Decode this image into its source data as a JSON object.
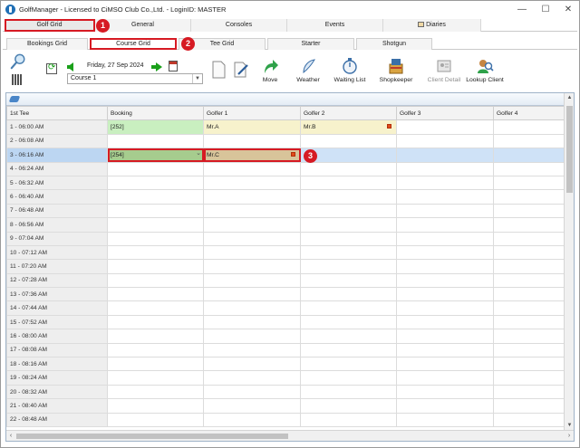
{
  "window": {
    "title": "GolfManager - Licensed to CiMSO Club Co.,Ltd. - LoginID: MASTER",
    "controls": [
      "—",
      "☐",
      "✕"
    ]
  },
  "main_tabs": [
    "Golf Grid",
    "General",
    "Consoles",
    "Events",
    "Diaries"
  ],
  "sub_tabs": [
    "Bookings Grid",
    "Course Grid",
    "Tee Grid",
    "Starter",
    "Shotgun"
  ],
  "badges": [
    "1",
    "2",
    "3"
  ],
  "date_nav": {
    "date": "Friday, 27 Sep 2024"
  },
  "course_select": {
    "value": "Course 1"
  },
  "toolbar": [
    {
      "label": "Move",
      "icon": "move-arrow-icon"
    },
    {
      "label": "Weather",
      "icon": "weather-icon"
    },
    {
      "label": "Waiting List",
      "icon": "stopwatch-icon"
    },
    {
      "label": "Shopkeeper",
      "icon": "shopkeeper-icon"
    },
    {
      "label": "Client Detail",
      "icon": "client-detail-icon"
    },
    {
      "label": "Lookup Client",
      "icon": "lookup-client-icon"
    }
  ],
  "grid": {
    "columns": [
      "1st Tee",
      "Booking",
      "Golfer 1",
      "Golfer 2",
      "Golfer 3",
      "Golfer 4"
    ],
    "rows": [
      {
        "tee": "1 - 06:00 AM",
        "booking": "[252]",
        "g1": "Mr.A",
        "g2": "Mr.B"
      },
      {
        "tee": "2 - 06:08 AM",
        "booking": "",
        "g1": "",
        "g2": ""
      },
      {
        "tee": "3 - 06:16 AM",
        "booking": "[254]",
        "g1": "Mr.C",
        "g2": ""
      },
      {
        "tee": "4 - 06:24 AM"
      },
      {
        "tee": "5 - 06:32 AM"
      },
      {
        "tee": "6 - 06:40 AM"
      },
      {
        "tee": "7 - 06:48 AM"
      },
      {
        "tee": "8 - 06:56 AM"
      },
      {
        "tee": "9 - 07:04 AM"
      },
      {
        "tee": "10 - 07:12 AM"
      },
      {
        "tee": "11 - 07:20 AM"
      },
      {
        "tee": "12 - 07:28 AM"
      },
      {
        "tee": "13 - 07:36 AM"
      },
      {
        "tee": "14 - 07:44 AM"
      },
      {
        "tee": "15 - 07:52 AM"
      },
      {
        "tee": "16 - 08:00 AM"
      },
      {
        "tee": "17 - 08:08 AM"
      },
      {
        "tee": "18 - 08:16 AM"
      },
      {
        "tee": "19 - 08:24 AM"
      },
      {
        "tee": "20 - 08:32 AM"
      },
      {
        "tee": "21 - 08:40 AM"
      },
      {
        "tee": "22 - 08:48 AM"
      }
    ]
  },
  "colors": {
    "highlight_red": "#d61a23",
    "booking_green": "#c9efc0",
    "golfer_yellow": "#f7f2cc",
    "selected_row": "#cfe2f7"
  }
}
